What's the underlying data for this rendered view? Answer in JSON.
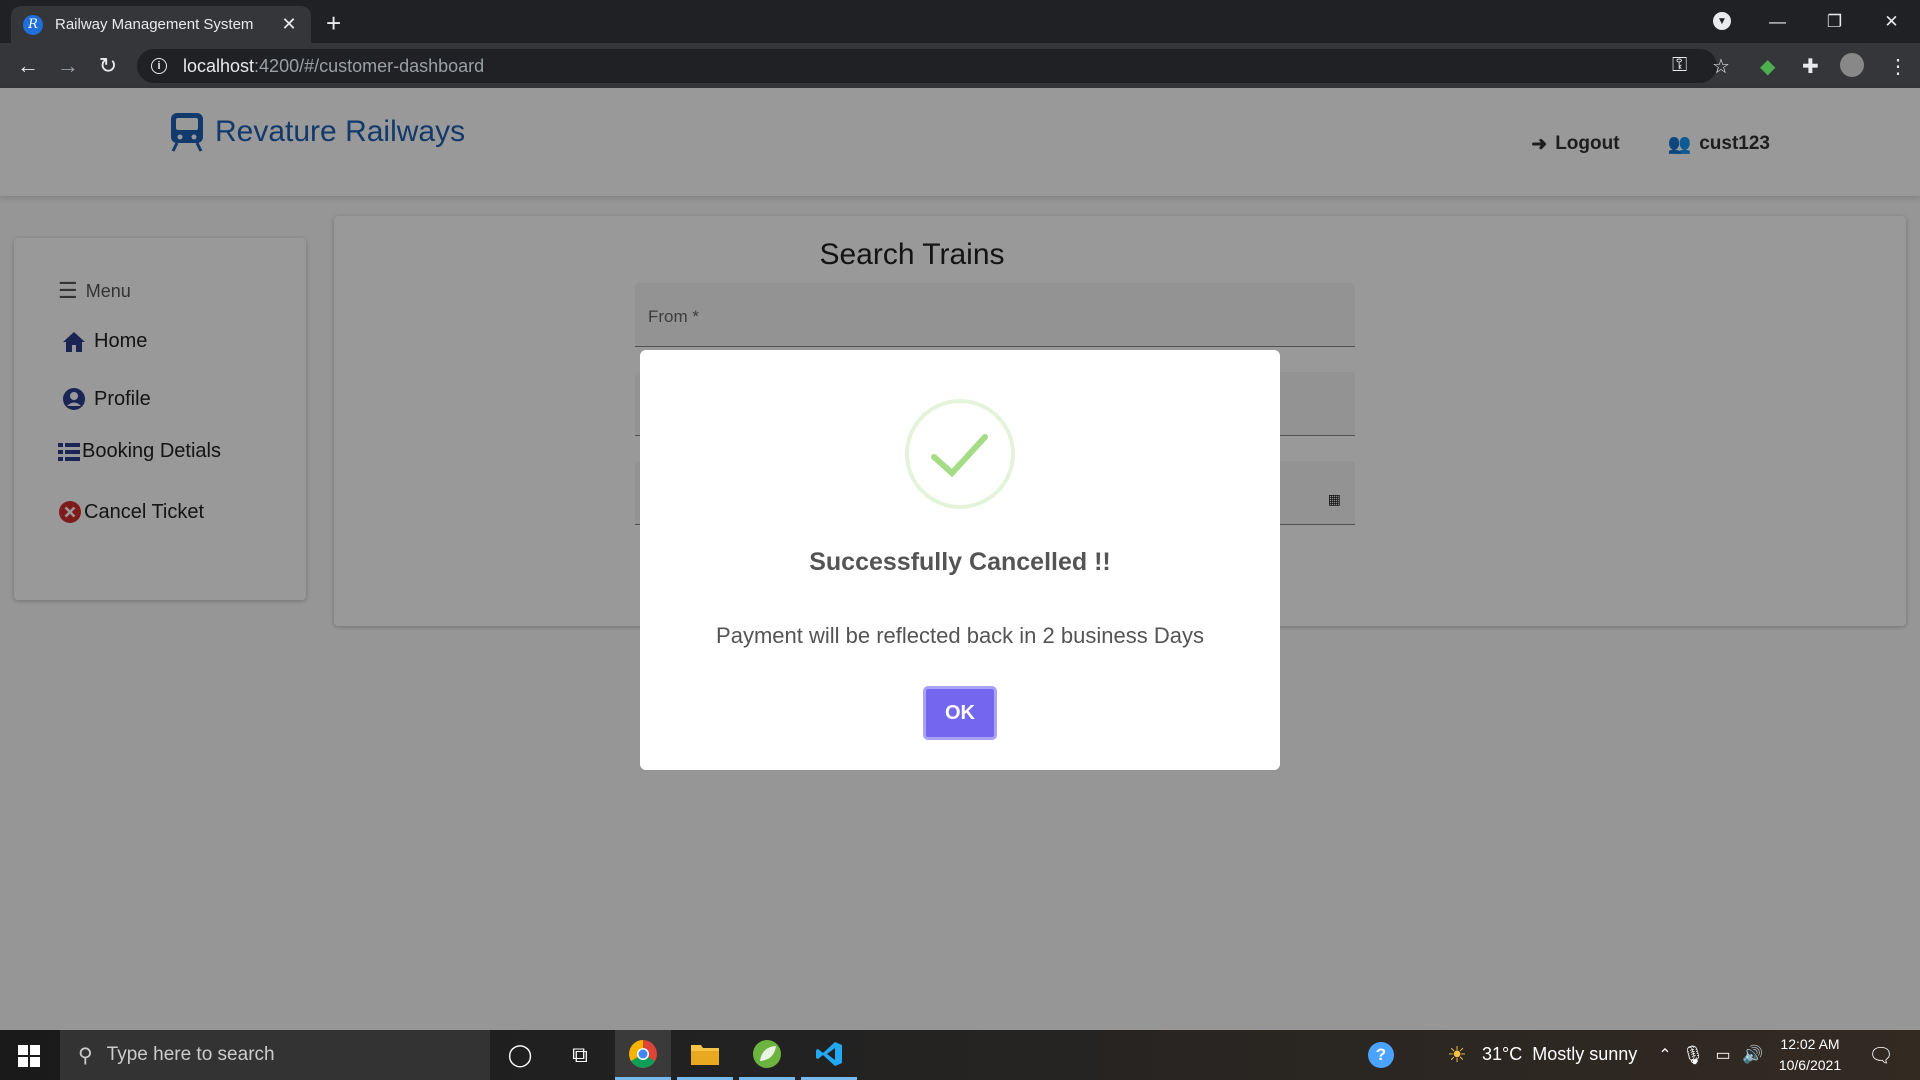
{
  "browser": {
    "tab_title": "Railway Management System",
    "tab_favicon": "R",
    "url_host": "localhost",
    "url_path": ":4200/#/customer-dashboard"
  },
  "navbar": {
    "brand": "Revature Railways",
    "logout_label": "Logout",
    "user_label": "cust123"
  },
  "sidebar": {
    "menu_label": "Menu",
    "items": [
      {
        "label": "Home",
        "icon": "home-icon"
      },
      {
        "label": "Profile",
        "icon": "user-circle-icon"
      },
      {
        "label": "Booking Detials",
        "icon": "list-icon"
      },
      {
        "label": "Cancel Ticket",
        "icon": "cancel-icon"
      }
    ]
  },
  "search": {
    "title": "Search Trains",
    "from_label": "From *"
  },
  "modal": {
    "title": "Successfully Cancelled !!",
    "message": "Payment will be reflected back in 2 business Days",
    "ok_label": "OK"
  },
  "taskbar": {
    "search_placeholder": "Type here to search",
    "weather": "31°C  Mostly sunny",
    "time": "12:02 AM",
    "date": "10/6/2021"
  },
  "colors": {
    "brand": "#1f5fb5",
    "ok_button": "#7367f0",
    "success_check": "#a5dc86"
  }
}
